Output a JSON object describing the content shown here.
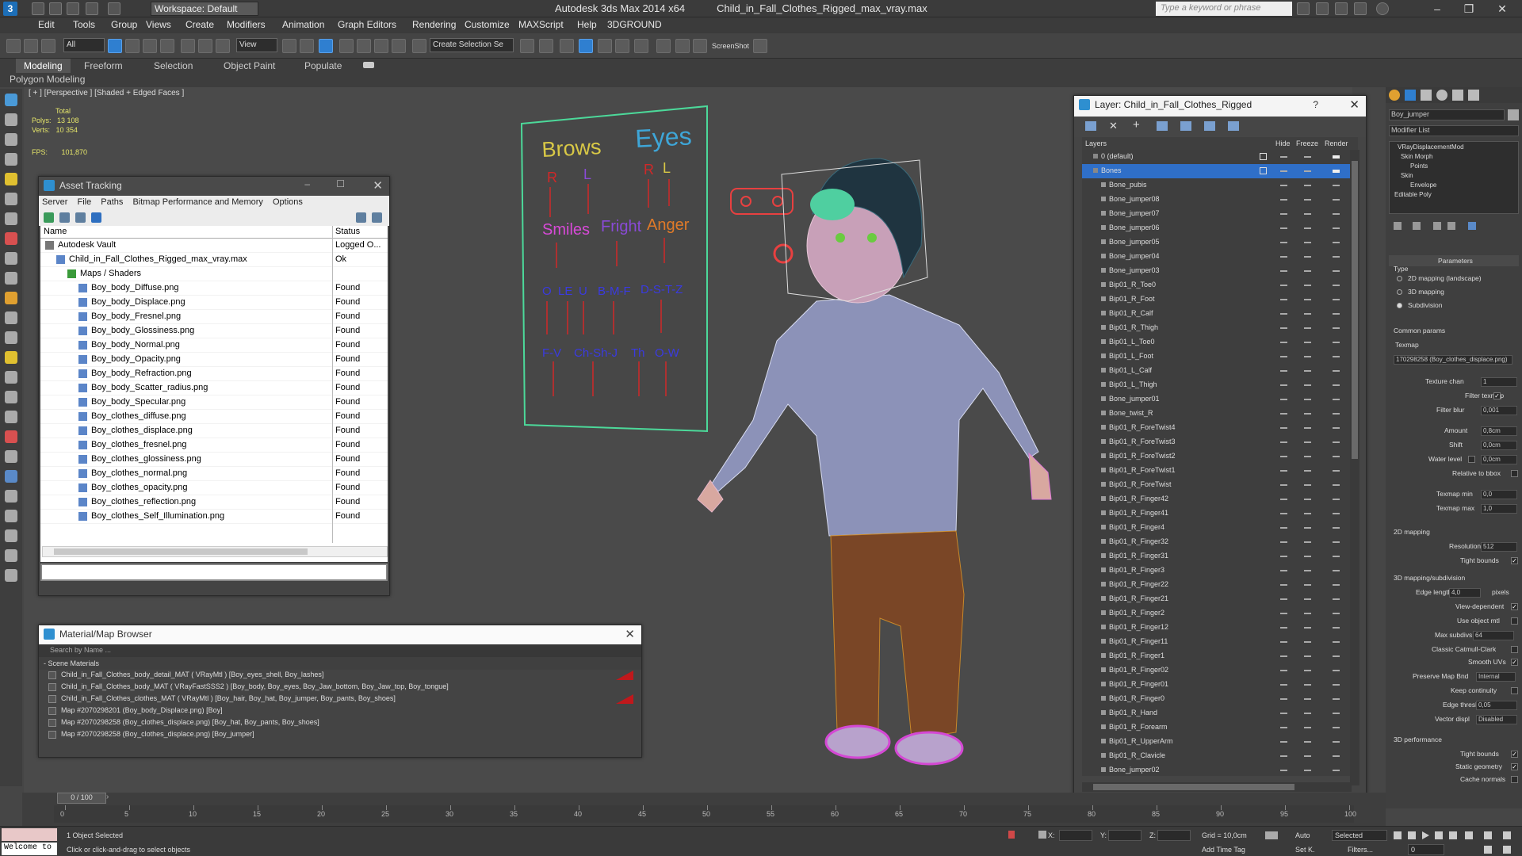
{
  "app": {
    "workspace": "Workspace: Default",
    "title": "Autodesk 3ds Max  2014 x64",
    "file": "Child_in_Fall_Clothes_Rigged_max_vray.max",
    "search_placeholder": "Type a keyword or phrase"
  },
  "menu": [
    "Edit",
    "Tools",
    "Group",
    "Views",
    "Create",
    "Modifiers",
    "Animation",
    "Graph Editors",
    "Rendering",
    "Customize",
    "MAXScript",
    "Help",
    "3DGROUND"
  ],
  "toolbar": {
    "filter": "All",
    "view": "View",
    "selection_set": "Create Selection Se",
    "screenshot": "ScreenShot"
  },
  "ribbon": {
    "tabs": [
      "Modeling",
      "Freeform",
      "Selection",
      "Object Paint",
      "Populate"
    ],
    "sub": "Polygon Modeling"
  },
  "viewport": {
    "label": "[ + ] [Perspective ] [Shaded + Edged Faces ]",
    "stats": {
      "total": "Total",
      "polys_label": "Polys:",
      "polys": "13 108",
      "verts_label": "Verts:",
      "verts": "10 354",
      "fps_label": "FPS:",
      "fps": "101,870"
    },
    "board": {
      "brows": "Brows",
      "eyes": "Eyes",
      "r": "R",
      "l": "L",
      "smiles": "Smiles",
      "fright": "Fright",
      "anger": "Anger",
      "row2": [
        "O",
        "LE",
        "U",
        "B-M-F",
        "D-S-T-Z"
      ],
      "row3": [
        "F-V",
        "Ch-Sh-J",
        "Th",
        "O-W"
      ]
    }
  },
  "asset_tracking": {
    "title": "Asset Tracking",
    "menu": [
      "Server",
      "File",
      "Paths",
      "Bitmap Performance and Memory",
      "Options"
    ],
    "col_name": "Name",
    "col_status": "Status",
    "rows": [
      {
        "name": "Autodesk Vault",
        "status": "Logged O...",
        "indent": 0
      },
      {
        "name": "Child_in_Fall_Clothes_Rigged_max_vray.max",
        "status": "Ok",
        "indent": 1
      },
      {
        "name": "Maps / Shaders",
        "status": "",
        "indent": 2
      },
      {
        "name": "Boy_body_Diffuse.png",
        "status": "Found",
        "indent": 3
      },
      {
        "name": "Boy_body_Displace.png",
        "status": "Found",
        "indent": 3
      },
      {
        "name": "Boy_body_Fresnel.png",
        "status": "Found",
        "indent": 3
      },
      {
        "name": "Boy_body_Glossiness.png",
        "status": "Found",
        "indent": 3
      },
      {
        "name": "Boy_body_Normal.png",
        "status": "Found",
        "indent": 3
      },
      {
        "name": "Boy_body_Opacity.png",
        "status": "Found",
        "indent": 3
      },
      {
        "name": "Boy_body_Refraction.png",
        "status": "Found",
        "indent": 3
      },
      {
        "name": "Boy_body_Scatter_radius.png",
        "status": "Found",
        "indent": 3
      },
      {
        "name": "Boy_body_Specular.png",
        "status": "Found",
        "indent": 3
      },
      {
        "name": "Boy_clothes_diffuse.png",
        "status": "Found",
        "indent": 3
      },
      {
        "name": "Boy_clothes_displace.png",
        "status": "Found",
        "indent": 3
      },
      {
        "name": "Boy_clothes_fresnel.png",
        "status": "Found",
        "indent": 3
      },
      {
        "name": "Boy_clothes_glossiness.png",
        "status": "Found",
        "indent": 3
      },
      {
        "name": "Boy_clothes_normal.png",
        "status": "Found",
        "indent": 3
      },
      {
        "name": "Boy_clothes_opacity.png",
        "status": "Found",
        "indent": 3
      },
      {
        "name": "Boy_clothes_reflection.png",
        "status": "Found",
        "indent": 3
      },
      {
        "name": "Boy_clothes_Self_Illumination.png",
        "status": "Found",
        "indent": 3
      }
    ]
  },
  "material_browser": {
    "title": "Material/Map Browser",
    "search": "Search by Name ...",
    "section": "- Scene Materials",
    "rows": [
      {
        "text": "Child_in_Fall_Clothes_body_detail_MAT ( VRayMtl ) [Boy_eyes_shell, Boy_lashes]",
        "red": true
      },
      {
        "text": "Child_in_Fall_Clothes_body_MAT ( VRayFastSSS2 ) [Boy_body, Boy_eyes, Boy_Jaw_bottom, Boy_Jaw_top, Boy_tongue]",
        "red": false
      },
      {
        "text": "Child_in_Fall_Clothes_clothes_MAT ( VRayMtl ) [Boy_hair, Boy_hat, Boy_jumper, Boy_pants, Boy_shoes]",
        "red": true
      },
      {
        "text": "Map #2070298201 (Boy_body_Displace.png) [Boy]",
        "red": false
      },
      {
        "text": "Map #2070298258 (Boy_clothes_displace.png) [Boy_hat, Boy_pants, Boy_shoes]",
        "red": false
      },
      {
        "text": "Map #2070298258 (Boy_clothes_displace.png) [Boy_jumper]",
        "red": false
      }
    ]
  },
  "layer_window": {
    "title": "Layer: Child_in_Fall_Clothes_Rigged",
    "help": "?",
    "col_layers": "Layers",
    "col_hide": "Hide",
    "col_freeze": "Freeze",
    "col_render": "Render",
    "rows": [
      "0 (default)",
      "Bones",
      "Bone_pubis",
      "Bone_jumper08",
      "Bone_jumper07",
      "Bone_jumper06",
      "Bone_jumper05",
      "Bone_jumper04",
      "Bone_jumper03",
      "Bip01_R_Toe0",
      "Bip01_R_Foot",
      "Bip01_R_Calf",
      "Bip01_R_Thigh",
      "Bip01_L_Toe0",
      "Bip01_L_Foot",
      "Bip01_L_Calf",
      "Bip01_L_Thigh",
      "Bone_jumper01",
      "Bone_twist_R",
      "Bip01_R_ForeTwist4",
      "Bip01_R_ForeTwist3",
      "Bip01_R_ForeTwist2",
      "Bip01_R_ForeTwist1",
      "Bip01_R_ForeTwist",
      "Bip01_R_Finger42",
      "Bip01_R_Finger41",
      "Bip01_R_Finger4",
      "Bip01_R_Finger32",
      "Bip01_R_Finger31",
      "Bip01_R_Finger3",
      "Bip01_R_Finger22",
      "Bip01_R_Finger21",
      "Bip01_R_Finger2",
      "Bip01_R_Finger12",
      "Bip01_R_Finger11",
      "Bip01_R_Finger1",
      "Bip01_R_Finger02",
      "Bip01_R_Finger01",
      "Bip01_R_Finger0",
      "Bip01_R_Hand",
      "Bip01_R_Forearm",
      "Bip01_R_UpperArm",
      "Bip01_R_Clavicle",
      "Bone_jumper02"
    ]
  },
  "command_panel": {
    "object_name": "Boy_jumper",
    "modifier_list": "Modifier List",
    "stack": [
      "VRayDisplacementMod",
      "Skin Morph",
      "Points",
      "Skin",
      "Envelope",
      "Editable Poly"
    ],
    "parameters": "Parameters",
    "type_label": "Type",
    "type_options": [
      "2D mapping (landscape)",
      "3D mapping",
      "Subdivision"
    ],
    "common_params": "Common params",
    "texmap_label": "Texmap",
    "texmap_value": "170298258 (Boy_clothes_displace.png)",
    "texture_chan_label": "Texture chan",
    "texture_chan": "1",
    "filter_texmap": "Filter texmap",
    "filter_blur_label": "Filter blur",
    "filter_blur": "0,001",
    "amount_label": "Amount",
    "amount": "0,8cm",
    "shift_label": "Shift",
    "shift": "0,0cm",
    "water_label": "Water level",
    "water": "0,0cm",
    "relative_bbox": "Relative to bbox",
    "texmap_min_label": "Texmap min",
    "texmap_min": "0,0",
    "texmap_max_label": "Texmap max",
    "texmap_max": "1,0",
    "mapping2d": "2D mapping",
    "resolution_label": "Resolution",
    "resolution": "512",
    "tight_bounds": "Tight bounds",
    "mapping3d": "3D mapping/subdivision",
    "edge_length_label": "Edge length",
    "edge_length": "4,0",
    "pixels": "pixels",
    "view_dependent": "View-dependent",
    "use_object_mtl": "Use object mtl",
    "max_subdivs_label": "Max subdivs",
    "max_subdivs": "64",
    "catmull": "Classic Catmull-Clark",
    "smooth_uvs": "Smooth UVs",
    "preserve_label": "Preserve Map Bnd",
    "preserve": "Internal",
    "keep_continuity": "Keep continuity",
    "edge_thresh_label": "Edge thresh",
    "edge_thresh": "0,05",
    "vector_disp_label": "Vector displ",
    "vector_disp": "Disabled",
    "perf": "3D performance",
    "tight_bounds2": "Tight bounds",
    "static_geometry": "Static geometry",
    "cache_normals": "Cache normals"
  },
  "timeline": {
    "frame": "0 / 100",
    "ticks": [
      "0",
      "5",
      "10",
      "15",
      "20",
      "25",
      "30",
      "35",
      "40",
      "45",
      "50",
      "55",
      "60",
      "65",
      "70",
      "75",
      "80",
      "85",
      "90",
      "95",
      "100"
    ]
  },
  "status": {
    "listener": "Welcome to",
    "selected": "1 Object Selected",
    "hint": "Click or click-and-drag to select objects",
    "x": "X:",
    "y": "Y:",
    "z": "Z:",
    "grid": "Grid = 10,0cm",
    "add_time_tag": "Add Time Tag",
    "auto": "Auto",
    "set_k": "Set K.",
    "key_mode": "Selected",
    "filters": "Filters...",
    "frame": "0"
  }
}
